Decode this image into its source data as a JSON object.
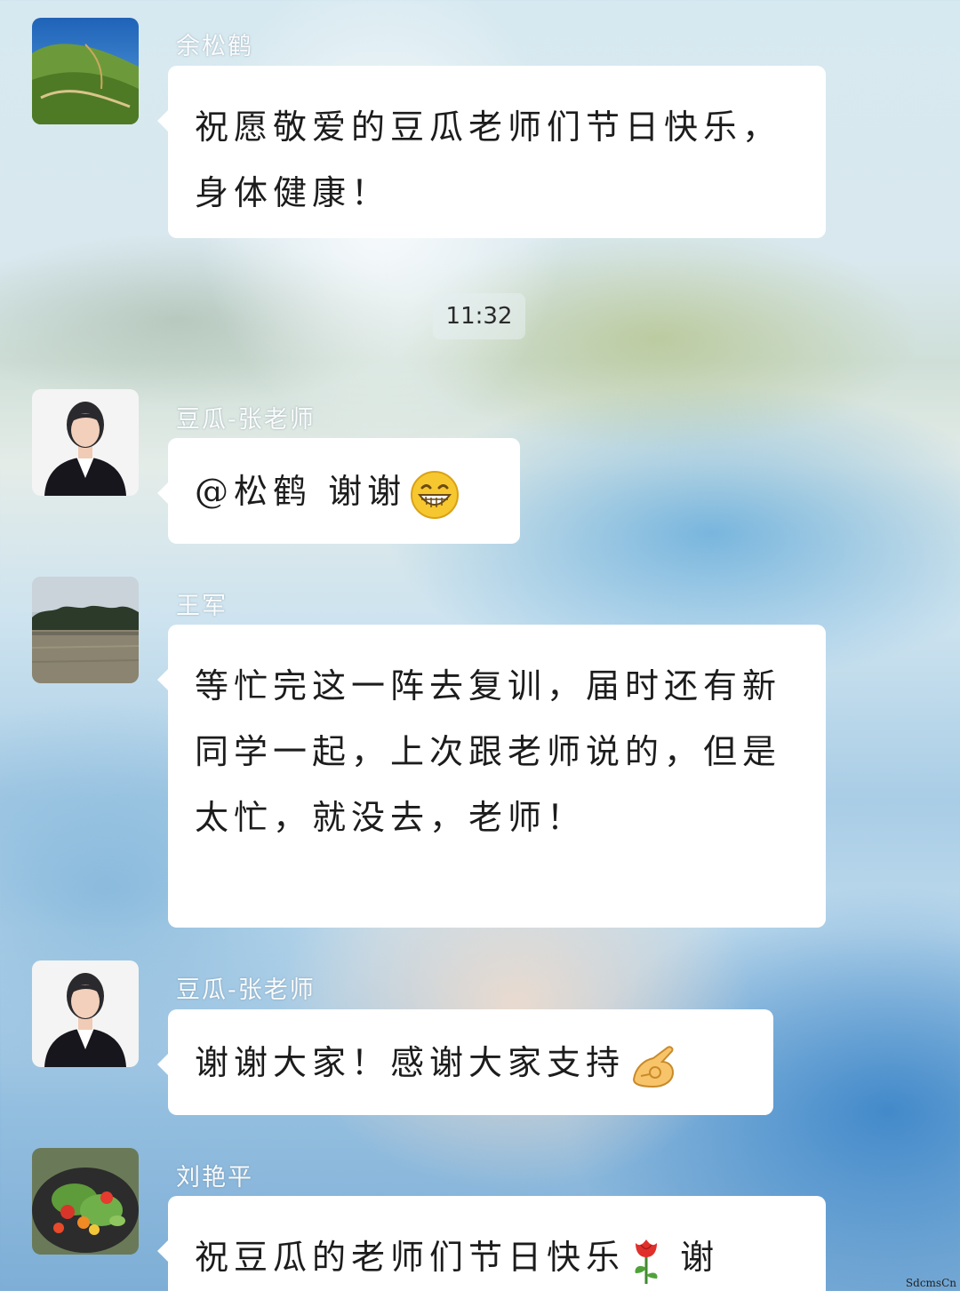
{
  "chat": {
    "messages": [
      {
        "sender": "余松鹤",
        "avatar": "landscape-photo",
        "text": "祝愿敬爱的豆瓜老师们节日快乐，身体健康！"
      },
      {
        "sender": "豆瓜-张老师",
        "avatar": "woman-in-suit-photo",
        "text": "@松鹤  谢谢",
        "emoji": "grinning-face-icon"
      },
      {
        "sender": "王军",
        "avatar": "lakeside-photo",
        "text": "等忙完这一阵去复训，届时还有新同学一起，上次跟老师说的，但是太忙，就没去，老师！"
      },
      {
        "sender": "豆瓜-张老师",
        "avatar": "woman-in-suit-photo",
        "text": "谢谢大家！感谢大家支持",
        "emoji": "ok-hand-icon"
      },
      {
        "sender": "刘艳平",
        "avatar": "salad-photo",
        "text": "祝豆瓜的老师们节日快乐",
        "emoji": "rose-icon",
        "trailing_text": " 谢"
      }
    ],
    "timestamp": "11:32"
  },
  "watermark": "SdcmsCn"
}
